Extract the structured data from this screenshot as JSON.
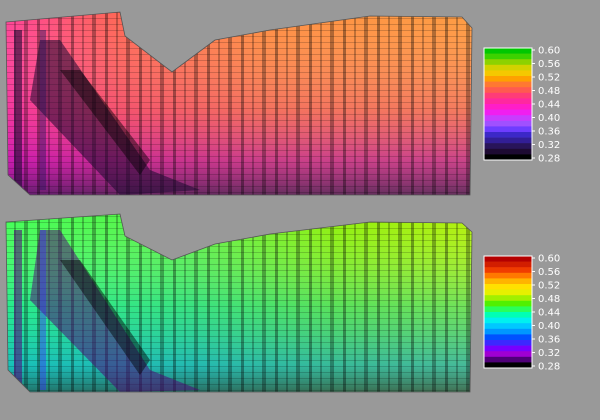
{
  "panels": [
    {
      "name": "top-map",
      "colormap": "warm",
      "colorbar": {
        "ticks": [
          "0.60",
          "0.56",
          "0.52",
          "0.48",
          "0.44",
          "0.40",
          "0.36",
          "0.32",
          "0.28"
        ],
        "colors": [
          "#00c800",
          "#3cd200",
          "#8cd200",
          "#d2d200",
          "#f5c800",
          "#ffa000",
          "#ff7832",
          "#ff5a50",
          "#ff3c78",
          "#ff28a0",
          "#ff1ec8",
          "#f01ef0",
          "#c83cff",
          "#a050ff",
          "#6e3cff",
          "#3c28c8",
          "#321e96",
          "#28145a",
          "#1e0a32",
          "#000000"
        ]
      }
    },
    {
      "name": "bottom-map",
      "colormap": "spectral",
      "colorbar": {
        "ticks": [
          "0.60",
          "0.56",
          "0.52",
          "0.48",
          "0.44",
          "0.40",
          "0.36",
          "0.32",
          "0.28"
        ],
        "colors": [
          "#b40000",
          "#d21e00",
          "#f03c00",
          "#ff7800",
          "#ffb400",
          "#ffe100",
          "#e6f000",
          "#a0f000",
          "#50f000",
          "#28ff5a",
          "#00ffb4",
          "#00f0f0",
          "#00c8ff",
          "#0096ff",
          "#0050ff",
          "#3c28ff",
          "#7800ff",
          "#a000d2",
          "#500078",
          "#000000"
        ]
      }
    }
  ],
  "chart_data": [
    {
      "type": "heatmap",
      "colormap": "warm",
      "legend": "colorbar right",
      "colorbar_range": [
        0.28,
        0.6
      ],
      "colorbar_ticks": [
        0.6,
        0.56,
        0.52,
        0.48,
        0.44,
        0.4,
        0.36,
        0.32,
        0.28
      ]
    },
    {
      "type": "heatmap",
      "colormap": "spectral",
      "legend": "colorbar right",
      "colorbar_range": [
        0.28,
        0.6
      ],
      "colorbar_ticks": [
        0.6,
        0.56,
        0.52,
        0.48,
        0.44,
        0.4,
        0.36,
        0.32,
        0.28
      ]
    }
  ]
}
